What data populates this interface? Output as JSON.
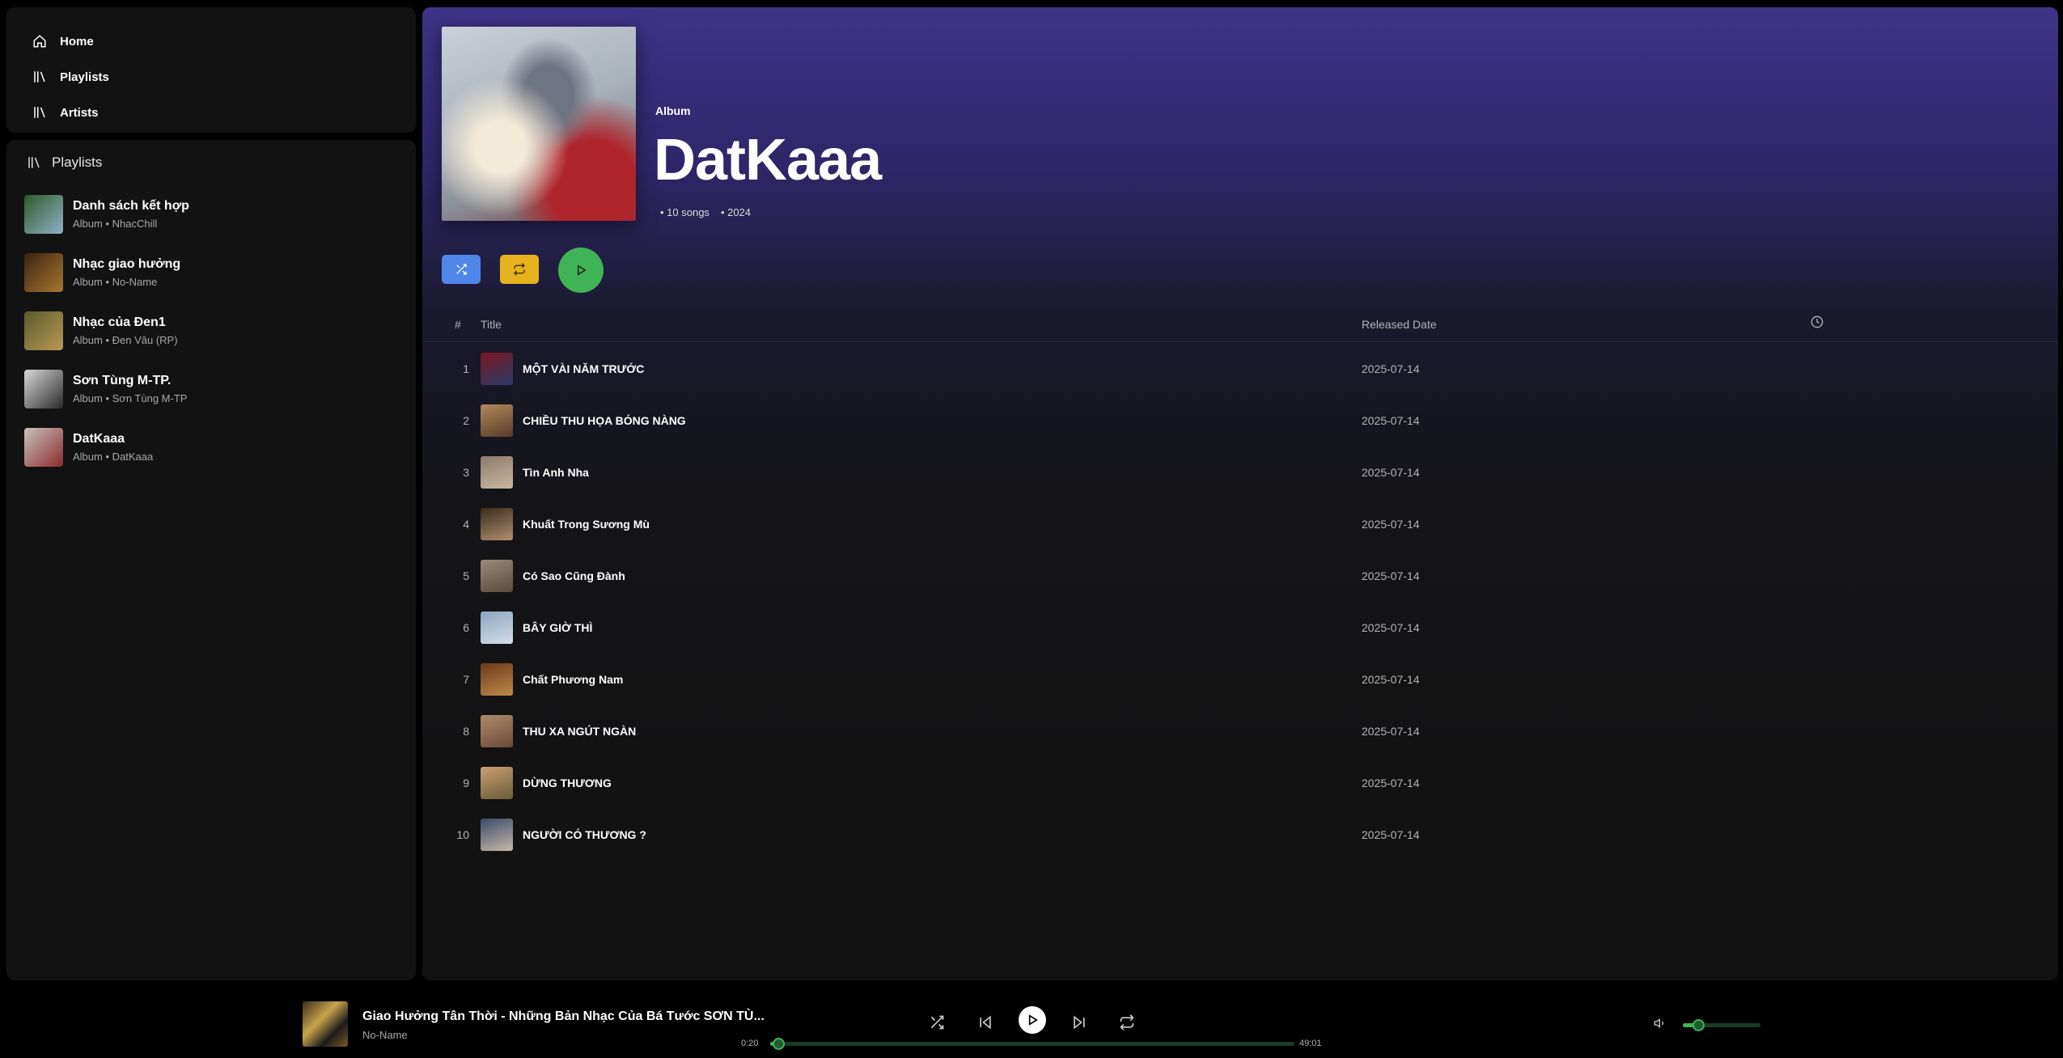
{
  "nav": {
    "items": [
      {
        "label": "Home",
        "icon": "home-icon"
      },
      {
        "label": "Playlists",
        "icon": "library-icon"
      },
      {
        "label": "Artists",
        "icon": "library-icon"
      }
    ]
  },
  "library": {
    "header": "Playlists",
    "items": [
      {
        "title": "Danh sách kết hợp",
        "subtitle": "Album • NhacChill",
        "colors": [
          "#2f5a2a",
          "#8fb1c6"
        ]
      },
      {
        "title": "Nhạc giao hưởng",
        "subtitle": "Album • No-Name",
        "colors": [
          "#3a2212",
          "#a8772f"
        ]
      },
      {
        "title": "Nhạc của Đen1",
        "subtitle": "Album • Đen Vâu (RP)",
        "colors": [
          "#5b5a2c",
          "#b59a54"
        ]
      },
      {
        "title": "Sơn Tùng M-TP.",
        "subtitle": "Album • Sơn Tùng M-TP",
        "colors": [
          "#d8d8d8",
          "#2b2b2b"
        ]
      },
      {
        "title": "DatKaaa",
        "subtitle": "Album • DatKaaa",
        "colors": [
          "#c8c3bd",
          "#8a2b2b"
        ]
      }
    ]
  },
  "album": {
    "type": "Album",
    "title": "DatKaaa",
    "songs": "• 10 songs",
    "year": "• 2024"
  },
  "table": {
    "col_num": "#",
    "col_title": "Title",
    "col_date": "Released Date",
    "rows": [
      {
        "num": "1",
        "title": "MỘT VÀI NĂM TRƯỚC",
        "date": "2025-07-14",
        "colors": [
          "#7a1820",
          "#2a3a6a"
        ]
      },
      {
        "num": "2",
        "title": "CHIỀU THU HỌA BÓNG NÀNG",
        "date": "2025-07-14",
        "colors": [
          "#b08a5a",
          "#5a3a2a"
        ]
      },
      {
        "num": "3",
        "title": "Tìn Anh Nha",
        "date": "2025-07-14",
        "colors": [
          "#8b7a6a",
          "#c9b9a0"
        ]
      },
      {
        "num": "4",
        "title": "Khuất Trong Sương Mù",
        "date": "2025-07-14",
        "colors": [
          "#3a2a1a",
          "#b09070"
        ]
      },
      {
        "num": "5",
        "title": "Có Sao Cũng Đành",
        "date": "2025-07-14",
        "colors": [
          "#9a8a7a",
          "#5a4a3a"
        ]
      },
      {
        "num": "6",
        "title": "BÂY GIỜ THÌ",
        "date": "2025-07-14",
        "colors": [
          "#8aa6c2",
          "#d4dde6"
        ]
      },
      {
        "num": "7",
        "title": "Chất Phương Nam",
        "date": "2025-07-14",
        "colors": [
          "#6a3a1a",
          "#c08a4a"
        ]
      },
      {
        "num": "8",
        "title": "THU XA NGÚT NGÀN",
        "date": "2025-07-14",
        "colors": [
          "#b08a6a",
          "#6a4a3a"
        ]
      },
      {
        "num": "9",
        "title": "DỪNG THƯƠNG",
        "date": "2025-07-14",
        "colors": [
          "#c9a070",
          "#6a5a3a"
        ]
      },
      {
        "num": "10",
        "title": "NGƯỜI CÓ THƯƠNG ?",
        "date": "2025-07-14",
        "colors": [
          "#3a4a6a",
          "#c9b9a9"
        ]
      }
    ]
  },
  "player": {
    "title": "Giao Hưởng Tân Thời - Những Bản Nhạc Của Bá Tước SƠN TÙ...",
    "artist": "No-Name",
    "current_time": "0:20",
    "total_time": "49:01",
    "progress": 0.007,
    "volume": 0.2
  },
  "colors": {
    "accent_green": "#3fb355",
    "shuffle_blue": "#4f86e8",
    "repeat_yellow": "#e6b21d"
  }
}
